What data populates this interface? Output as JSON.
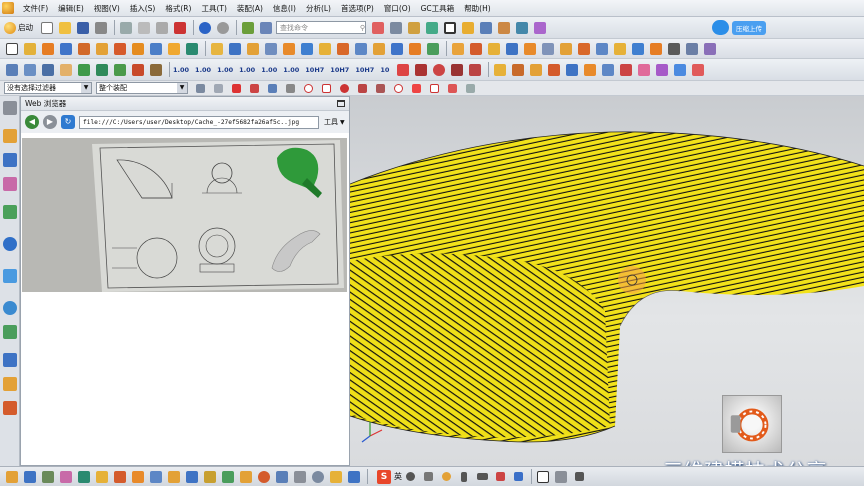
{
  "menubar": {
    "items": [
      "文件(F)",
      "编辑(E)",
      "视图(V)",
      "插入(S)",
      "格式(R)",
      "工具(T)",
      "装配(A)",
      "信息(I)",
      "分析(L)",
      "首选项(P)",
      "窗口(O)",
      "GC工具箱",
      "帮助(H)"
    ]
  },
  "toolbar": {
    "start_label": "启动",
    "command_search_placeholder": "查找命令",
    "cloud_upload_label": "压缩上传",
    "dimension_buttons": [
      "1.00",
      "1.00",
      "1.00",
      "1.00",
      "1.00",
      "1.00",
      "10H7",
      "10H7",
      "10H7",
      "10"
    ]
  },
  "selection": {
    "filter_value": "没有选择过滤器",
    "assembly_value": "整个装配"
  },
  "browser": {
    "title": "Web 浏览器",
    "url": "file:///C:/Users/user/Desktop/Cache_-27ef5682fa26af5c..jpg",
    "tools_label": "工具"
  },
  "watermark": "三维建模技术分享",
  "ime": {
    "logo": "S",
    "lang": "英"
  },
  "colors": {
    "surface_yellow": "#f2e21a",
    "accent_blue": "#2b8ee8",
    "panel_bg": "#d6dbe3"
  }
}
